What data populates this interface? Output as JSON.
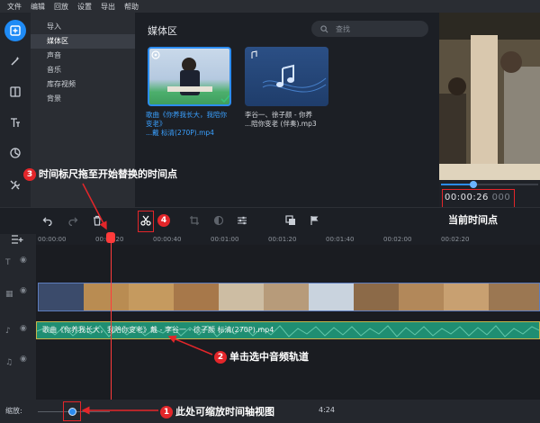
{
  "menu": [
    "文件",
    "编辑",
    "回放",
    "设置",
    "导出",
    "帮助"
  ],
  "categories": [
    "导入",
    "媒体区",
    "声音",
    "音乐",
    "库存视频",
    "背景"
  ],
  "selected_category": 1,
  "media": {
    "title": "媒体区",
    "search_placeholder": "查找",
    "items": [
      {
        "caption": "歌曲《你养我长大，我陪你变老》",
        "caption2": "...戴 标清(270P).mp4"
      },
      {
        "caption": "李谷一、徐子颜 - 你养",
        "caption2": "...陪你变老 (伴奏).mp3"
      }
    ]
  },
  "preview": {
    "timecode_main": "00:00:26",
    "timecode_frac": "000",
    "progress": 0.3
  },
  "ruler": [
    "00:00:00",
    "00:00:20",
    "00:00:40",
    "00:01:00",
    "00:01:20",
    "00:01:40",
    "00:02:00",
    "00:02:20"
  ],
  "audio_clip_label": "歌曲《你养我长大，我陪你变老》戴 - 李谷一 - 徐子颜 标清(270P).mp4",
  "zoom_label": "缩放:",
  "duration": "4:24",
  "annotations": {
    "a1": {
      "num": "1",
      "text": "此处可缩放时间轴视图"
    },
    "a2": {
      "num": "2",
      "text": "单击选中音频轨道"
    },
    "a3": {
      "num": "3",
      "text": "时间标尺拖至开始替换的时间点"
    },
    "a4": {
      "num": "4"
    },
    "current_time_label": "当前时间点"
  },
  "colors": {
    "accent": "#1f8bf5",
    "annotation": "#e3262a",
    "audio": "#1f8e72"
  }
}
